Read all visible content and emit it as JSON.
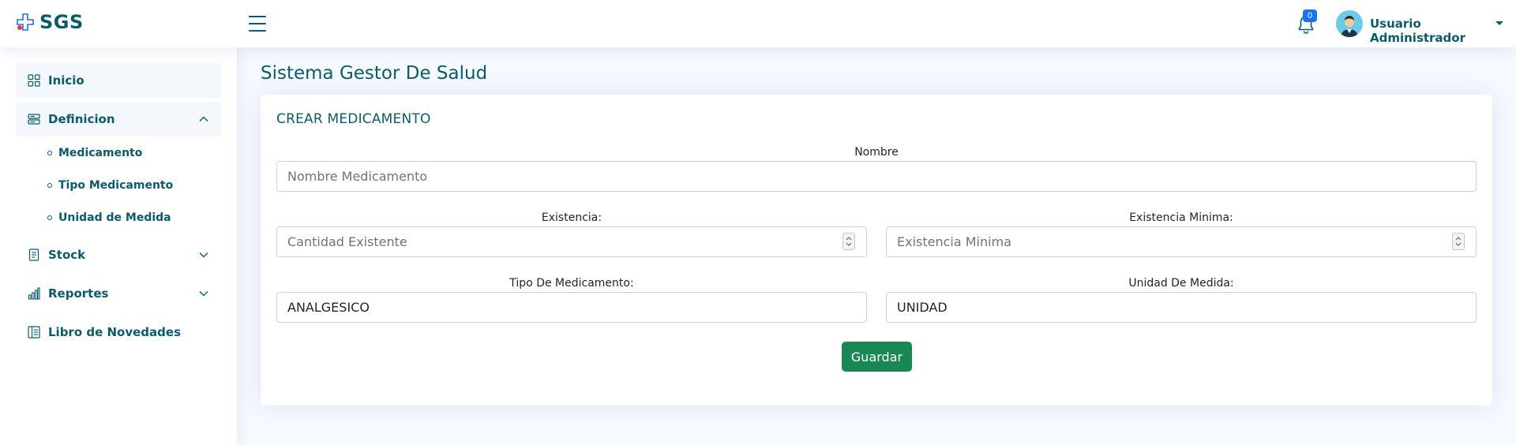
{
  "brand": {
    "name": "SGS"
  },
  "header": {
    "notification_count": "0",
    "user_name": "Usuario Administrador"
  },
  "sidebar": {
    "items": [
      {
        "label": "Inicio",
        "icon": "grid-icon",
        "active": true
      },
      {
        "label": "Definicion",
        "icon": "menu-button-icon",
        "expanded": true,
        "children": [
          {
            "label": "Medicamento"
          },
          {
            "label": "Tipo Medicamento"
          },
          {
            "label": "Unidad de Medida"
          }
        ]
      },
      {
        "label": "Stock",
        "icon": "journal-icon",
        "expanded": false
      },
      {
        "label": "Reportes",
        "icon": "bar-chart-icon",
        "expanded": false
      },
      {
        "label": "Libro de Novedades",
        "icon": "layout-text-icon"
      }
    ]
  },
  "main": {
    "page_title": "Sistema Gestor De Salud",
    "card_title": "CREAR MEDICAMENTO",
    "form": {
      "nombre": {
        "label": "Nombre",
        "placeholder": "Nombre Medicamento",
        "value": ""
      },
      "existencia": {
        "label": "Existencia:",
        "placeholder": "Cantidad Existente",
        "value": ""
      },
      "existencia_minima": {
        "label": "Existencia Minima:",
        "placeholder": "Existencia Minima",
        "value": ""
      },
      "tipo_medicamento": {
        "label": "Tipo De Medicamento:",
        "value": "ANALGESICO"
      },
      "unidad_medida": {
        "label": "Unidad De Medida:",
        "value": "UNIDAD"
      },
      "save_label": "Guardar"
    }
  },
  "colors": {
    "primary_text": "#0b5c6b",
    "save_button": "#198754",
    "badge": "#1a73e8",
    "background": "#f6f9ff"
  }
}
